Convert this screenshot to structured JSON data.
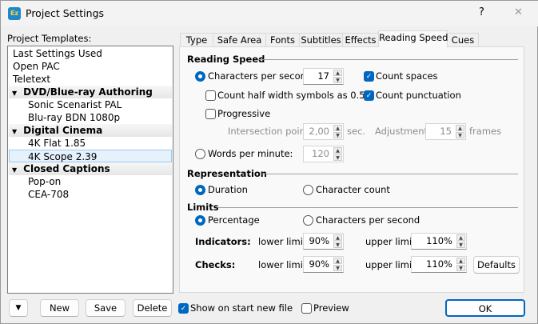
{
  "window": {
    "title": "Project Settings",
    "help": "?",
    "close": "✕",
    "icon_text": "Ez"
  },
  "templates": {
    "label": "Project Templates:",
    "items": [
      {
        "label": "Last Settings Used"
      },
      {
        "label": "Open PAC"
      },
      {
        "label": "Teletext"
      },
      {
        "label": "DVD/Blue-ray Authoring",
        "group": true
      },
      {
        "label": "Sonic Scenarist PAL"
      },
      {
        "label": "Blu-ray BDN 1080p"
      },
      {
        "label": "Digital Cinema",
        "group": true
      },
      {
        "label": "4K Flat 1.85"
      },
      {
        "label": "4K Scope 2.39",
        "selected": true
      },
      {
        "label": "Closed Captions",
        "group": true
      },
      {
        "label": "Pop-on"
      },
      {
        "label": "CEA-708"
      }
    ]
  },
  "tabs": [
    "Type",
    "Safe Area",
    "Fonts",
    "Subtitles",
    "Effects",
    "Reading Speed",
    "Cues"
  ],
  "active_tab": "Reading Speed",
  "reading_speed": {
    "header": "Reading Speed",
    "cps_label": "Characters per second:",
    "cps_value": "17",
    "cps_selected": true,
    "count_half": "Count half width symbols as 0.5",
    "count_half_checked": false,
    "progressive": "Progressive",
    "progressive_checked": false,
    "intersection_label": "Intersection point:",
    "intersection_value": "2,00",
    "sec": "sec.",
    "adjustment_label": "Adjustment:",
    "adjustment_value": "15",
    "frames": "frames",
    "wpm_label": "Words per minute:",
    "wpm_value": "120",
    "wpm_selected": false,
    "count_spaces": "Count spaces",
    "count_spaces_checked": true,
    "count_punct": "Count punctuation",
    "count_punct_checked": true
  },
  "representation": {
    "header": "Representation",
    "duration": "Duration",
    "duration_selected": true,
    "char_count": "Character count"
  },
  "limits": {
    "header": "Limits",
    "percentage": "Percentage",
    "percentage_selected": true,
    "cps": "Characters per second",
    "indicators": "Indicators:",
    "checks": "Checks:",
    "lower": "lower limit:",
    "upper": "upper limit:",
    "ind_lower": "90%",
    "ind_upper": "110%",
    "chk_lower": "90%",
    "chk_upper": "110%",
    "defaults": "Defaults"
  },
  "footer": {
    "new": "New",
    "save": "Save",
    "delete": "Delete",
    "show_on_start": "Show on start new file",
    "show_on_start_checked": true,
    "preview": "Preview",
    "preview_checked": false,
    "ok": "OK"
  },
  "colors": {
    "accent": "#0067c0",
    "selection": "#e5f1fb"
  }
}
